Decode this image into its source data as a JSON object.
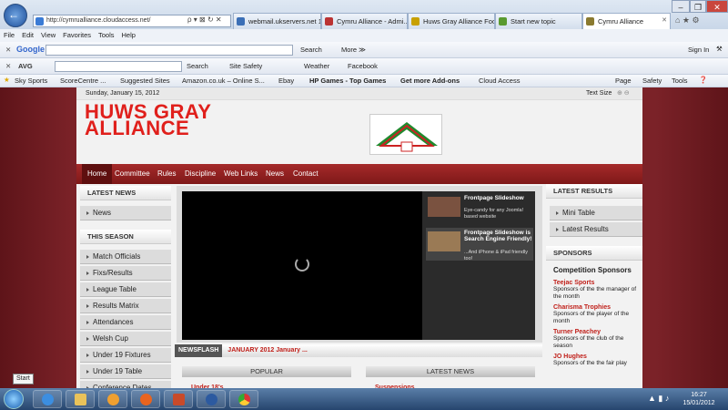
{
  "browser": {
    "address": "http://cymrualliance.cloudaccess.net/",
    "tabs": [
      {
        "label": "webmail.ukservers.net 1...",
        "color": "#3b6fb6"
      },
      {
        "label": "Cymru Alliance - Admi...",
        "color": "#b33"
      },
      {
        "label": "Huws Gray Alliance Foo...",
        "color": "#c8a000"
      },
      {
        "label": "Start new topic",
        "color": "#5a9a2f"
      },
      {
        "label": "Cymru Alliance",
        "color": "#8a7a30"
      }
    ],
    "menu": [
      "File",
      "Edit",
      "View",
      "Favorites",
      "Tools",
      "Help"
    ],
    "google": {
      "label": "Google",
      "search": "Search",
      "more": "More ≫",
      "signin": "Sign In"
    },
    "avg": {
      "label": "AVG",
      "search": "Search",
      "site_safety": "Site Safety",
      "weather": "Weather",
      "facebook": "Facebook"
    },
    "favorites": [
      "Sky Sports",
      "ScoreCentre ...",
      "Suggested Sites",
      "Amazon.co.uk – Online S...",
      "Ebay",
      "HP Games - Top Games",
      "Get more Add-ons",
      "Cloud Access"
    ],
    "cmd": {
      "page": "Page",
      "safety": "Safety",
      "tools": "Tools"
    }
  },
  "site": {
    "date": "Sunday, January 15, 2012",
    "text_size": "Text Size",
    "title_line1": "HUWS GRAY",
    "title_line2": "ALLIANCE",
    "nav": [
      "Home",
      "Committee",
      "Rules",
      "Discipline",
      "Web Links",
      "News",
      "Contact"
    ],
    "latest_news": {
      "heading": "LATEST NEWS",
      "items": [
        "News"
      ]
    },
    "this_season": {
      "heading": "THIS SEASON",
      "items": [
        "Match Officials",
        "Fixs/Results",
        "League Table",
        "Results Matrix",
        "Attendances",
        "Welsh Cup",
        "Under 19 Fixtures",
        "Under 19 Table",
        "Conference Dates"
      ]
    },
    "slides": [
      {
        "title": "Frontpage Slideshow",
        "sub": "Eye-candy for any Joomla! based website"
      },
      {
        "title": "Frontpage Slideshow is Search Engine Friendly!",
        "sub": "...And iPhone & iPad friendly too!"
      }
    ],
    "newsflash": {
      "label": "NEWSFLASH",
      "text": "JANUARY 2012 January ..."
    },
    "popular": {
      "heading": "POPULAR",
      "items": [
        "Under 18's"
      ]
    },
    "latest_news_bottom": {
      "heading": "LATEST NEWS",
      "items": [
        "Suspensions"
      ]
    },
    "latest_results": {
      "heading": "LATEST RESULTS",
      "items": [
        "Mini Table",
        "Latest Results"
      ]
    },
    "sponsors": {
      "heading": "SPONSORS",
      "title": "Competition Sponsors",
      "list": [
        {
          "name": "Teejac Sports",
          "desc": "Sponsors of the the manager of the month"
        },
        {
          "name": "Charisma Trophies",
          "desc": "Sponsors of the player of the month"
        },
        {
          "name": "Turner Peachey",
          "desc": "Sponsors of the club of the season"
        },
        {
          "name": "JO Hughes",
          "desc": "Sponsors of the the fair play"
        }
      ]
    }
  },
  "taskbar": {
    "tooltip": "Start",
    "time": "16:27",
    "date": "15/01/2012"
  }
}
